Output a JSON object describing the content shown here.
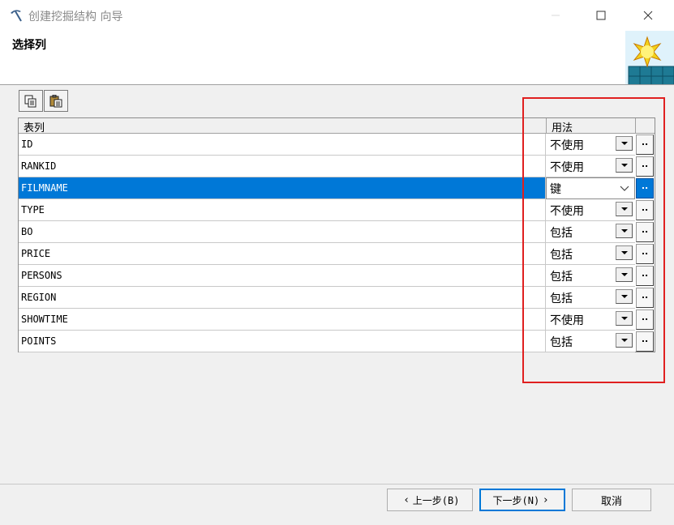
{
  "window": {
    "title": "创建挖掘结构 向导",
    "app_icon": "pickaxe-icon",
    "controls": [
      "minimize-icon",
      "maximize-icon",
      "close-icon"
    ]
  },
  "header": {
    "title": "选择列",
    "image": "wizard-sun-cube-icon"
  },
  "toolbar": {
    "buttons": [
      "copy-icon",
      "paste-icon"
    ]
  },
  "grid": {
    "columns": [
      "表列",
      "用法"
    ],
    "more_label": "..",
    "rows": [
      {
        "name": "ID",
        "usage": "不使用"
      },
      {
        "name": "RANKID",
        "usage": "不使用"
      },
      {
        "name": "FILMNAME",
        "usage": "键",
        "selected": true
      },
      {
        "name": "TYPE",
        "usage": "不使用"
      },
      {
        "name": "BO",
        "usage": "包括"
      },
      {
        "name": "PRICE",
        "usage": "包括"
      },
      {
        "name": "PERSONS",
        "usage": "包括"
      },
      {
        "name": "REGION",
        "usage": "包括"
      },
      {
        "name": "SHOWTIME",
        "usage": "不使用"
      },
      {
        "name": "POINTS",
        "usage": "包括"
      }
    ]
  },
  "footer": {
    "back_label": "上一步(B)",
    "next_label": "下一步(N)",
    "cancel_label": "取消"
  },
  "colors": {
    "selection": "#0078d7",
    "highlight_box": "#e02020"
  }
}
